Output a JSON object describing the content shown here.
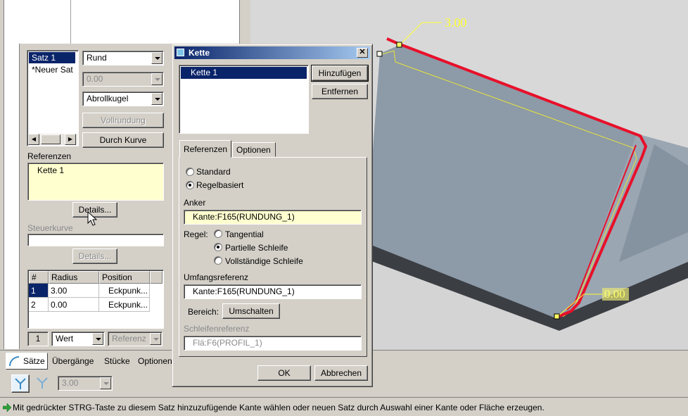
{
  "viewport": {
    "dim_top": "3.00",
    "dim_bottom": "0.00",
    "colors": {
      "background": "#d8d8d8",
      "part_face": "#8c99a6",
      "edge_highlight": "#e8102a",
      "dimension": "#ffff33"
    }
  },
  "left_panel": {
    "sets_list": [
      "Satz 1",
      "*Neuer Sat"
    ],
    "shape_combo": "Rund",
    "value_combo": "0.00",
    "method_combo": "Abrollkugel",
    "full_round_btn": "Vollrundung",
    "through_curve_btn": "Durch Kurve",
    "references_label": "Referenzen",
    "references_items": [
      "Kette 1"
    ],
    "details_btn": "Details...",
    "driving_curve_label": "Steuerkurve",
    "details_btn2": "Details...",
    "table": {
      "headers": [
        "#",
        "Radius",
        "Position"
      ],
      "rows": [
        {
          "num": "1",
          "radius": "3.00",
          "position": "Eckpunk..."
        },
        {
          "num": "2",
          "radius": "0.00",
          "position": "Eckpunk..."
        }
      ]
    },
    "row_num": "1",
    "value_type_combo": "Wert",
    "reference_combo": "Referenz"
  },
  "bottom_tabs": [
    "Sätze",
    "Übergänge",
    "Stücke",
    "Optionen"
  ],
  "toolbar": {
    "radius_combo": "3.00"
  },
  "dialog": {
    "title": "Kette",
    "chains": [
      "Kette 1"
    ],
    "add_btn": "Hinzufügen",
    "remove_btn": "Entfernen",
    "tabs": [
      "Referenzen",
      "Optionen"
    ],
    "radio_standard": "Standard",
    "radio_rule_based": "Regelbasiert",
    "anchor_label": "Anker",
    "anchor_value": "Kante:F165(RUNDUNG_1)",
    "rule_label": "Regel:",
    "rule_tangential": "Tangential",
    "rule_partial_loop": "Partielle Schleife",
    "rule_full_loop": "Vollständige Schleife",
    "extent_label": "Umfangsreferenz",
    "extent_value": "Kante:F165(RUNDUNG_1)",
    "range_label": "Bereich:",
    "toggle_btn": "Umschalten",
    "loop_ref_label": "Schleifenreferenz",
    "loop_ref_value": "Flä:F6(PROFIL_1)",
    "ok_btn": "OK",
    "cancel_btn": "Abbrechen"
  },
  "status_bar": {
    "message": "Mit gedrückter STRG-Taste zu diesem Satz hinzuzufügende Kante wählen oder neuen Satz durch Auswahl einer Kante oder Fläche erzeugen."
  }
}
